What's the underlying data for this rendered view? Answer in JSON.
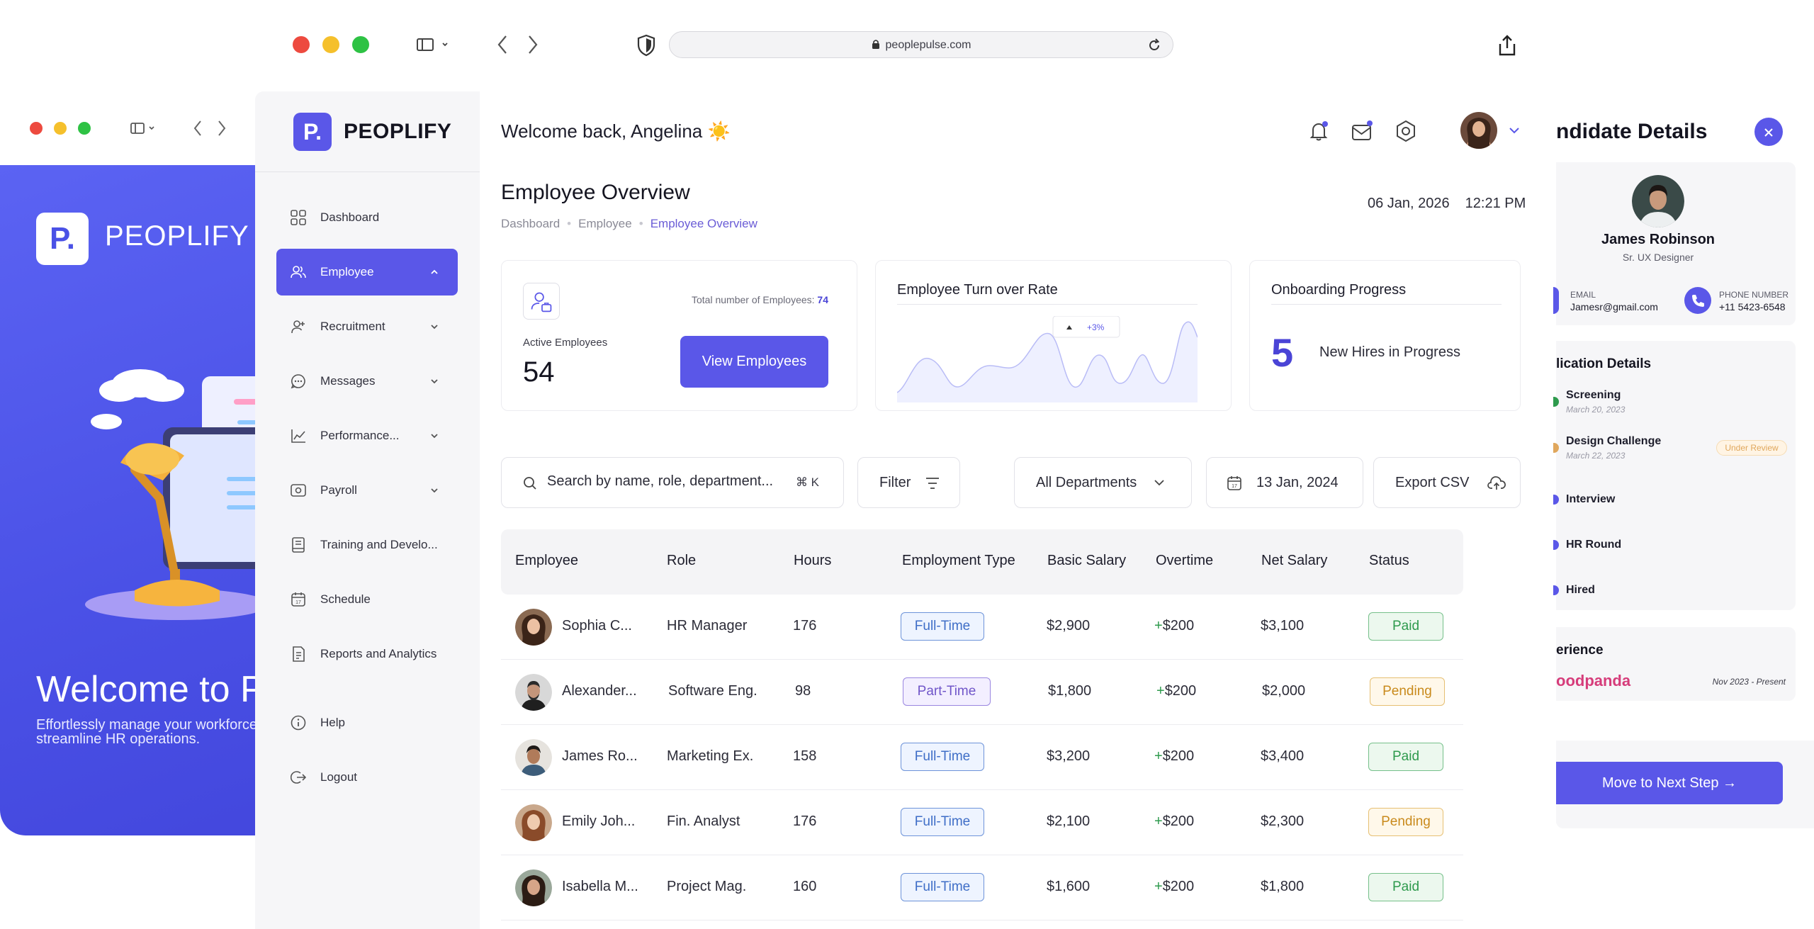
{
  "browser": {
    "url": "peoplepulse.com"
  },
  "back_window": {
    "logo_letter": "P.",
    "logo_text": "PEOPLIFY",
    "welcome": "Welcome to P",
    "tagline": "Effortlessly manage your workforce, streamline HR operations."
  },
  "sidebar": {
    "logo_letter": "P.",
    "logo_text": "PEOPLIFY",
    "items": [
      {
        "label": "Dashboard",
        "icon": "grid-icon"
      },
      {
        "label": "Employee",
        "icon": "users-icon",
        "active": true
      },
      {
        "label": "Recruitment",
        "icon": "user-plus-icon"
      },
      {
        "label": "Messages",
        "icon": "chat-icon"
      },
      {
        "label": "Performance...",
        "icon": "chart-line-icon"
      },
      {
        "label": "Payroll",
        "icon": "money-icon"
      },
      {
        "label": "Training and Develo...",
        "icon": "book-icon"
      },
      {
        "label": "Schedule",
        "icon": "calendar-icon"
      },
      {
        "label": "Reports and Analytics",
        "icon": "report-icon"
      },
      {
        "label": "Help",
        "icon": "info-icon"
      },
      {
        "label": "Logout",
        "icon": "logout-icon"
      }
    ]
  },
  "header": {
    "welcome": "Welcome back, Angelina ☀️",
    "title": "Employee Overview",
    "breadcrumb": [
      "Dashboard",
      "Employee",
      "Employee Overview"
    ],
    "date": "06 Jan, 2026",
    "time": "12:21 PM"
  },
  "cards": {
    "employees": {
      "total_label": "Total number of Employees:",
      "total_value": "74",
      "active_label": "Active Employees",
      "active_value": "54",
      "button": "View Employees"
    },
    "turnover": {
      "title": "Employee Turn over Rate",
      "badge": "+3%"
    },
    "onboarding": {
      "title": "Onboarding Progress",
      "value": "5",
      "text": "New Hires in Progress"
    }
  },
  "controls": {
    "search_placeholder": "Search by name, role, department...",
    "search_shortcut": "⌘ K",
    "filter": "Filter",
    "department": "All Departments",
    "date": "13 Jan, 2024",
    "export": "Export CSV"
  },
  "table": {
    "headers": [
      "Employee",
      "Role",
      "Hours",
      "Employment Type",
      "Basic Salary",
      "Overtime",
      "Net Salary",
      "Status"
    ],
    "rows": [
      {
        "name": "Sophia C...",
        "role": "HR Manager",
        "hours": "176",
        "type": "Full-Time",
        "basic": "$2,900",
        "overtime_sign": "+",
        "overtime": "$200",
        "net": "$3,100",
        "status": "Paid"
      },
      {
        "name": "Alexander...",
        "role": "Software Eng.",
        "hours": "98",
        "type": "Part-Time",
        "basic": "$1,800",
        "overtime_sign": "+",
        "overtime": "$200",
        "net": "$2,000",
        "status": "Pending"
      },
      {
        "name": "James Ro...",
        "role": "Marketing Ex.",
        "hours": "158",
        "type": "Full-Time",
        "basic": "$3,200",
        "overtime_sign": "+",
        "overtime": "$200",
        "net": "$3,400",
        "status": "Paid"
      },
      {
        "name": "Emily Joh...",
        "role": "Fin. Analyst",
        "hours": "176",
        "type": "Full-Time",
        "basic": "$2,100",
        "overtime_sign": "+",
        "overtime": "$200",
        "net": "$2,300",
        "status": "Pending"
      },
      {
        "name": "Isabella M...",
        "role": "Project Mag.",
        "hours": "160",
        "type": "Full-Time",
        "basic": "$1,600",
        "overtime_sign": "+",
        "overtime": "$200",
        "net": "$1,800",
        "status": "Paid"
      }
    ]
  },
  "candidate": {
    "title": "ndidate Details",
    "name": "James Robinson",
    "role": "Sr. UX Designer",
    "email_label": "EMAIL",
    "email": "Jamesr@gmail.com",
    "phone_label": "PHONE NUMBER",
    "phone": "+11 5423-6548",
    "application_title": "lication Details",
    "steps": [
      {
        "name": "Screening",
        "date": "March 20, 2023",
        "color": "#2e9a4d"
      },
      {
        "name": "Design Challenge",
        "date": "March 22, 2023",
        "color": "#e0a75c",
        "badge": "Under Review"
      },
      {
        "name": "Interview",
        "date": "",
        "color": "#5a57e8"
      },
      {
        "name": "HR Round",
        "date": "",
        "color": "#5a57e8"
      },
      {
        "name": "Hired",
        "date": "",
        "color": "#5a57e8"
      }
    ],
    "experience_title": "erience",
    "experience_company": "oodpanda",
    "experience_dates": "Nov 2023 - Present",
    "next_button": "Move to Next Step →"
  },
  "colors": {
    "brand": "#5a57e8",
    "paid": "#2e9a4d",
    "pending": "#c98a1c"
  }
}
